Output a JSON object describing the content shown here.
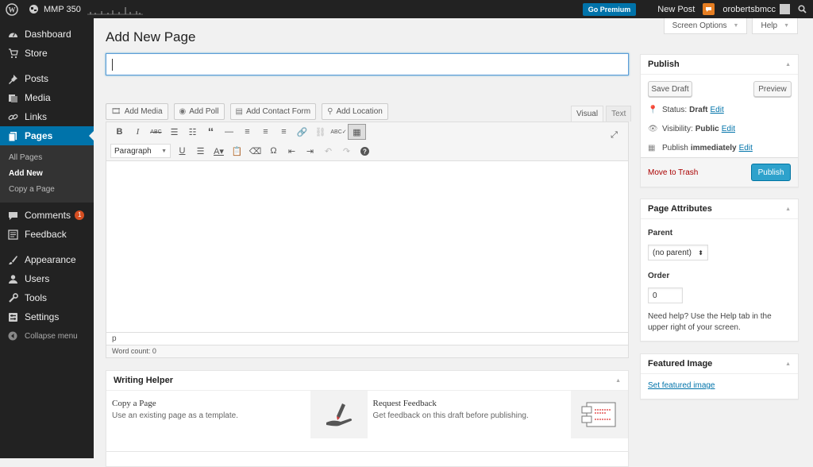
{
  "adminbar": {
    "site_name": "MMP 350",
    "go_premium": "Go Premium",
    "new_post": "New Post",
    "username": "orobertsbmcc"
  },
  "sidebar": {
    "items": [
      {
        "label": "Dashboard",
        "icon": "dashboard-icon"
      },
      {
        "label": "Store",
        "icon": "store-icon"
      },
      {
        "label": "Posts",
        "icon": "pin-icon"
      },
      {
        "label": "Media",
        "icon": "media-icon"
      },
      {
        "label": "Links",
        "icon": "link-icon"
      },
      {
        "label": "Pages",
        "icon": "pages-icon"
      },
      {
        "label": "Comments",
        "icon": "comment-icon",
        "badge": "1"
      },
      {
        "label": "Feedback",
        "icon": "feedback-icon"
      },
      {
        "label": "Appearance",
        "icon": "brush-icon"
      },
      {
        "label": "Users",
        "icon": "users-icon"
      },
      {
        "label": "Tools",
        "icon": "wrench-icon"
      },
      {
        "label": "Settings",
        "icon": "settings-icon"
      }
    ],
    "submenu": [
      "All Pages",
      "Add New",
      "Copy a Page"
    ],
    "collapse": "Collapse menu"
  },
  "screen_options": "Screen Options",
  "help": "Help",
  "page_title": "Add New Page",
  "title_input": {
    "value": "",
    "placeholder": ""
  },
  "media_buttons": [
    "Add Media",
    "Add Poll",
    "Add Contact Form",
    "Add Location"
  ],
  "editor": {
    "tab_visual": "Visual",
    "tab_text": "Text",
    "format_select": "Paragraph",
    "path": "p",
    "word_count": "Word count: 0"
  },
  "writing_helper": {
    "title": "Writing Helper",
    "items": [
      {
        "title": "Copy a Page",
        "desc": "Use an existing page as a template."
      },
      {
        "title": "Request Feedback",
        "desc": "Get feedback on this draft before publishing."
      }
    ]
  },
  "publish": {
    "title": "Publish",
    "save_draft": "Save Draft",
    "preview": "Preview",
    "status_label": "Status:",
    "status_value": "Draft",
    "visibility_label": "Visibility:",
    "visibility_value": "Public",
    "publish_label": "Publish",
    "publish_value": "immediately",
    "edit": "Edit",
    "move_to_trash": "Move to Trash",
    "publish_button": "Publish"
  },
  "page_attributes": {
    "title": "Page Attributes",
    "parent_label": "Parent",
    "parent_value": "(no parent)",
    "order_label": "Order",
    "order_value": "0",
    "help_text": "Need help? Use the Help tab in the upper right of your screen."
  },
  "featured_image": {
    "title": "Featured Image",
    "link": "Set featured image"
  },
  "colors": {
    "accent": "#0073aa",
    "sidebar": "#222222",
    "primary_button": "#2ea2cc",
    "trash": "#aa0000"
  }
}
